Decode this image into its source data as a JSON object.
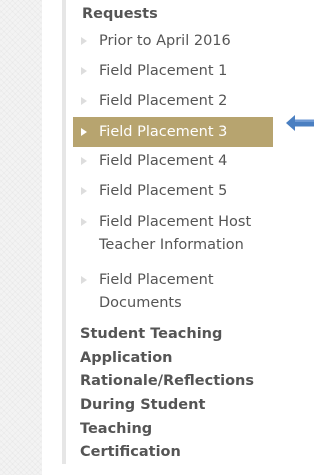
{
  "nav": {
    "top_label": "Requests",
    "sub_items": [
      {
        "label": "Prior to April 2016"
      },
      {
        "label": "Field Placement 1"
      },
      {
        "label": "Field Placement 2"
      },
      {
        "label": "Field Placement 3",
        "active": true
      },
      {
        "label": "Field Placement 4"
      },
      {
        "label": "Field Placement 5"
      },
      {
        "label": "Field Placement Host Teacher Information"
      },
      {
        "label": "Field Placement Documents"
      }
    ],
    "groups": [
      {
        "label": "Student Teaching Application"
      },
      {
        "label": "Rationale/Reflections"
      },
      {
        "label": "During Student Teaching"
      },
      {
        "label": "Certification"
      }
    ]
  },
  "pointer": {
    "icon": "left-arrow-icon",
    "color": "#4a7fc1"
  },
  "colors": {
    "active_bg": "#b7a46f",
    "text": "#555555"
  }
}
